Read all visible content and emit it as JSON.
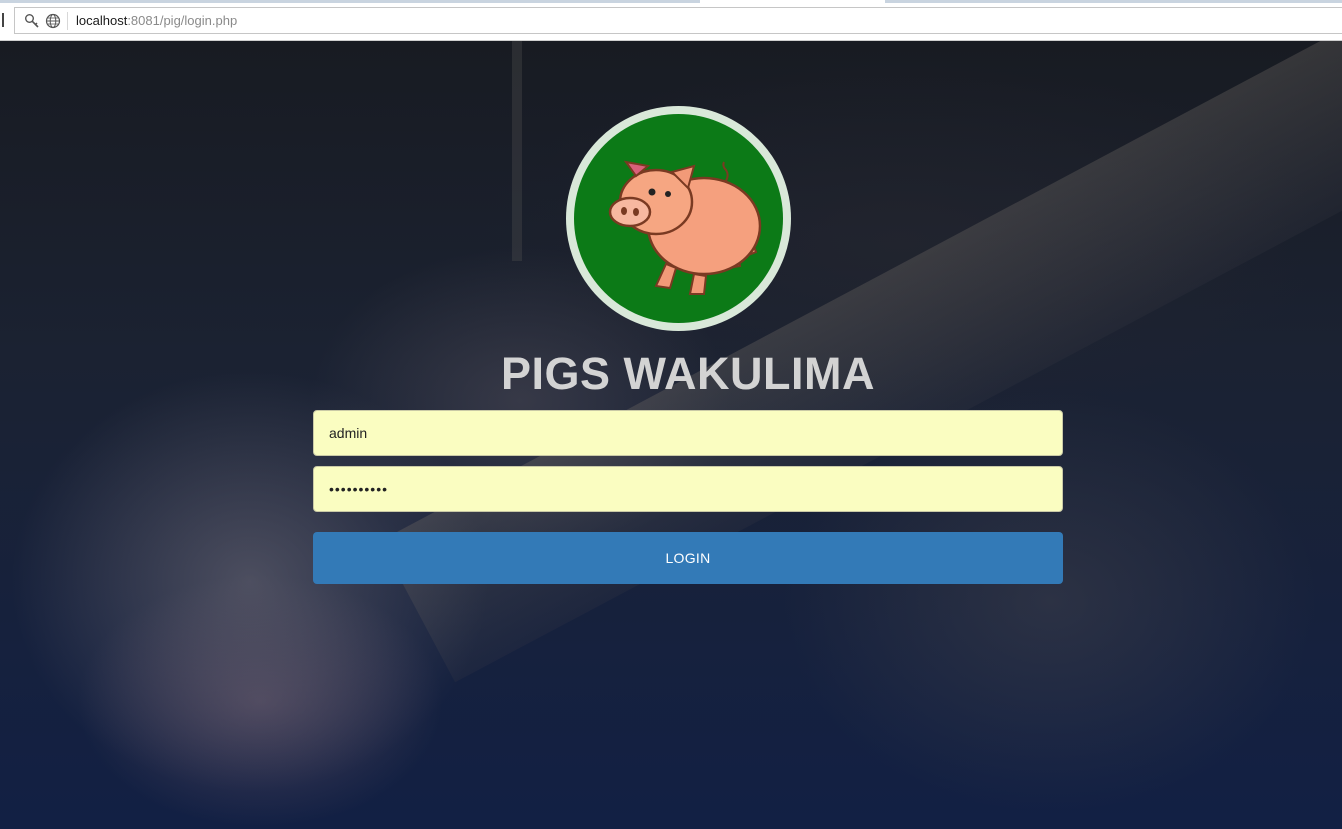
{
  "browser": {
    "url_host": "localhost",
    "url_rest": ":8081/pig/login.php"
  },
  "login": {
    "title": "PIGS WAKULIMA",
    "username_value": "admin",
    "password_value": "••••••••••",
    "button_label": "LOGIN"
  },
  "icons": {
    "security": "key-icon",
    "site": "globe-icon",
    "logo": "pig-logo"
  },
  "colors": {
    "button": "#337ab7",
    "field_bg": "#fafdc1",
    "logo_bg": "#0c7a17",
    "logo_ring": "#d9e8d9",
    "title": "#d3d3d3"
  }
}
